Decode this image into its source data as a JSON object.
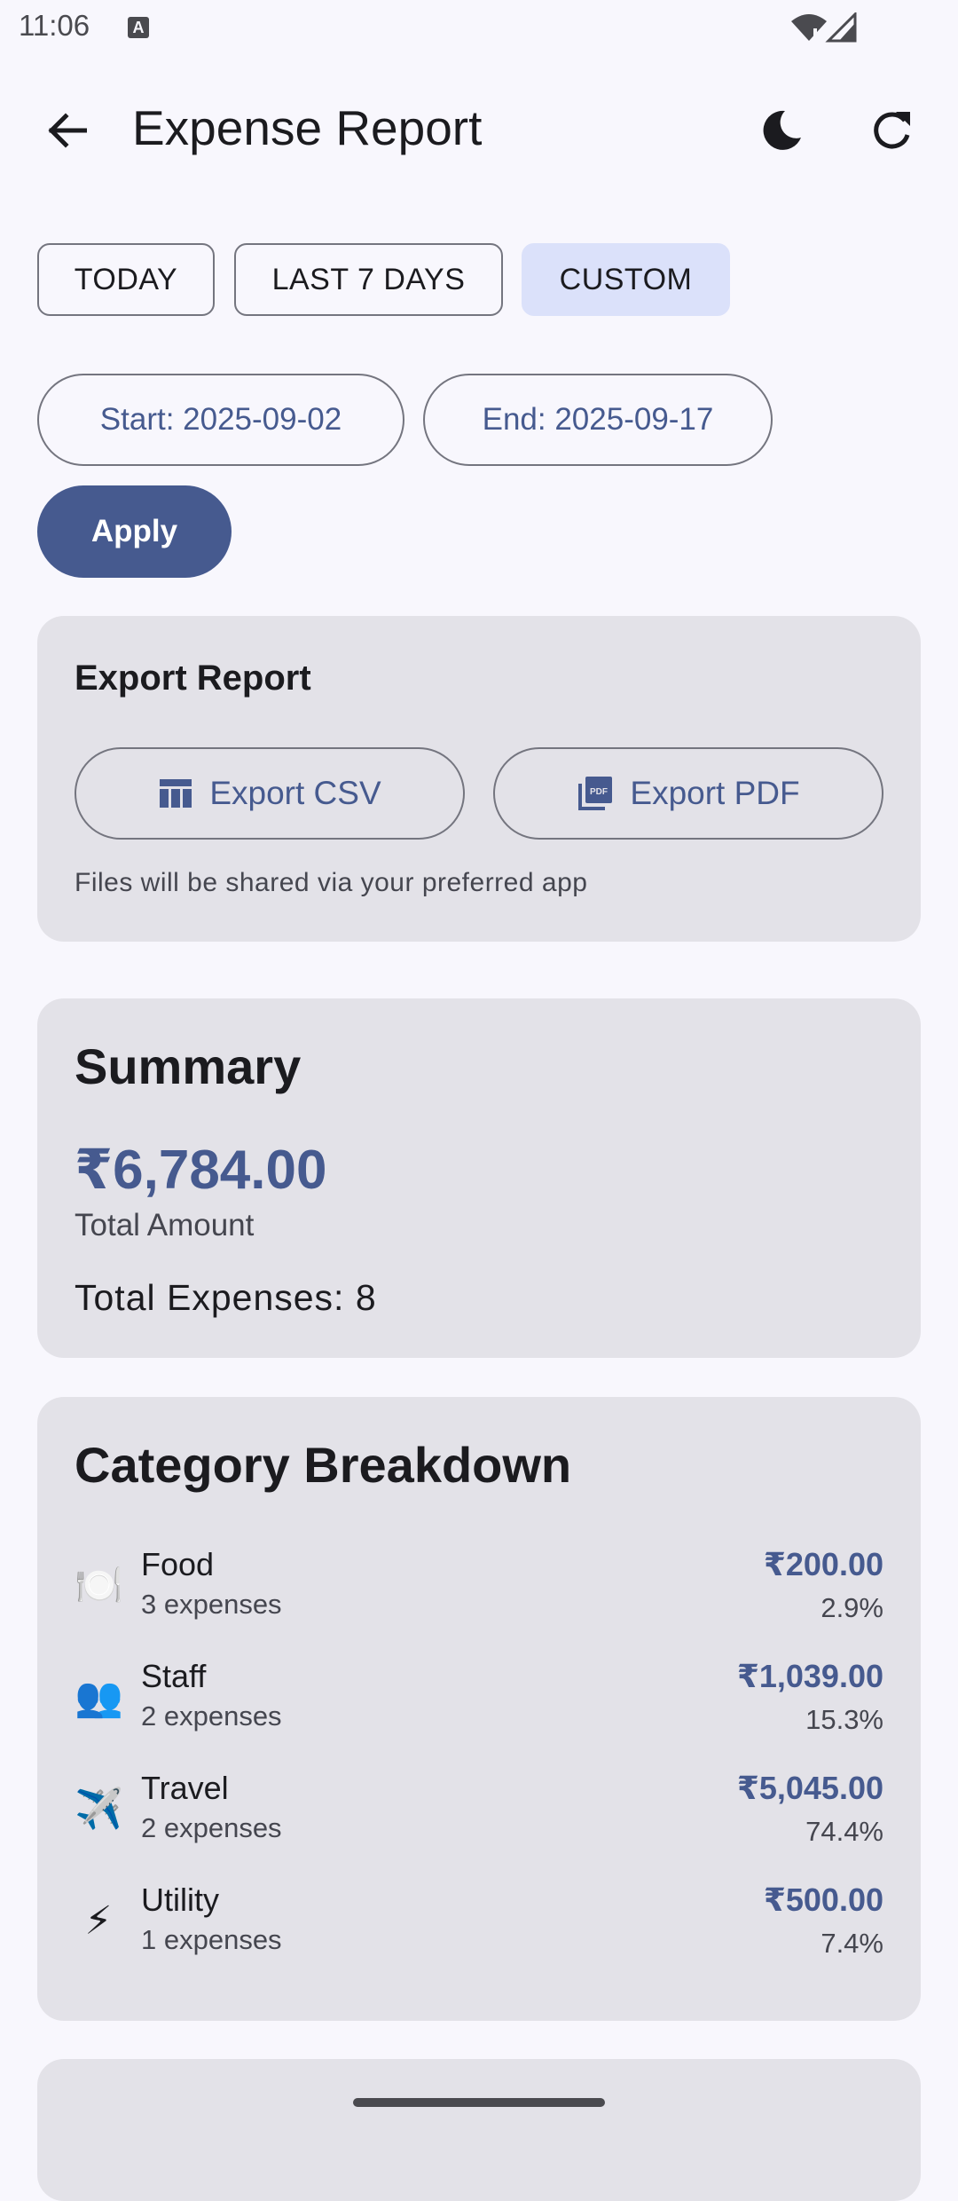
{
  "status_bar": {
    "time": "11:06",
    "notification_icon": "a-notification-icon"
  },
  "app_bar": {
    "title": "Expense Report",
    "back_icon": "arrow-back-icon",
    "theme_icon": "moon-icon",
    "refresh_icon": "refresh-icon"
  },
  "range_chips": {
    "today": "TODAY",
    "last7": "LAST 7 DAYS",
    "custom": "CUSTOM",
    "selected": "CUSTOM"
  },
  "date_range": {
    "start_label": "Start: 2025-09-02",
    "end_label": "End: 2025-09-17",
    "apply_label": "Apply"
  },
  "export": {
    "title": "Export Report",
    "csv_label": "Export CSV",
    "pdf_label": "Export PDF",
    "note": "Files will be shared via your preferred app"
  },
  "summary": {
    "title": "Summary",
    "total_amount": "₹6,784.00",
    "total_amount_label": "Total Amount",
    "total_expenses": "Total Expenses: 8"
  },
  "breakdown": {
    "title": "Category Breakdown",
    "items": [
      {
        "icon": "🍽️",
        "name": "Food",
        "count": "3 expenses",
        "amount": "₹200.00",
        "percent": "2.9%"
      },
      {
        "icon": "👥",
        "name": "Staff",
        "count": "2 expenses",
        "amount": "₹1,039.00",
        "percent": "15.3%"
      },
      {
        "icon": "✈️",
        "name": "Travel",
        "count": "2 expenses",
        "amount": "₹5,045.00",
        "percent": "74.4%"
      },
      {
        "icon": "⚡",
        "name": "Utility",
        "count": "1 expenses",
        "amount": "₹500.00",
        "percent": "7.4%"
      }
    ]
  },
  "colors": {
    "background": "#f8f7fd",
    "card": "#e3e2e8",
    "primary": "#465a8f",
    "selected_chip": "#dbe1fa"
  }
}
